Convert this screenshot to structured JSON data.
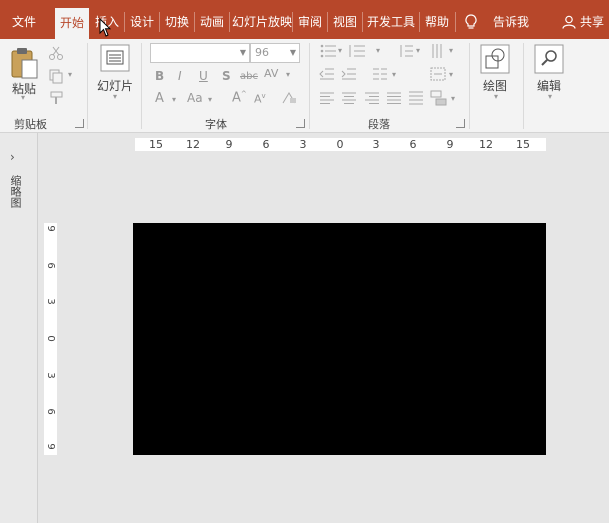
{
  "tabs": [
    {
      "label": "文件"
    },
    {
      "label": "开始"
    },
    {
      "label": "插入"
    },
    {
      "label": "设计"
    },
    {
      "label": "切换"
    },
    {
      "label": "动画"
    },
    {
      "label": "幻灯片放映"
    },
    {
      "label": "审阅"
    },
    {
      "label": "视图"
    },
    {
      "label": "开发工具"
    },
    {
      "label": "帮助"
    }
  ],
  "active_tab": "开始",
  "tell_me": "告诉我",
  "share": "共享",
  "ribbon": {
    "clipboard": {
      "paste_label": "粘贴",
      "group_label": "剪贴板"
    },
    "slides": {
      "new_slide_label": "幻灯片"
    },
    "font": {
      "font_name": "",
      "font_size": "96",
      "group_label": "字体"
    },
    "paragraph": {
      "group_label": "段落"
    },
    "drawing": {
      "label": "绘图"
    },
    "editing": {
      "label": "编辑"
    }
  },
  "nav_pane": {
    "label": "缩略图"
  },
  "ruler": {
    "horizontal": [
      "15",
      "12",
      "9",
      "6",
      "3",
      "0",
      "3",
      "6",
      "9",
      "12",
      "15"
    ],
    "vertical": [
      "9",
      "6",
      "3",
      "0",
      "3",
      "6",
      "9"
    ]
  },
  "colors": {
    "accent": "#b7472a",
    "ribbon_bg": "#f3f3f3",
    "workspace_bg": "#e6e6e6",
    "slide_bg": "#000000"
  }
}
